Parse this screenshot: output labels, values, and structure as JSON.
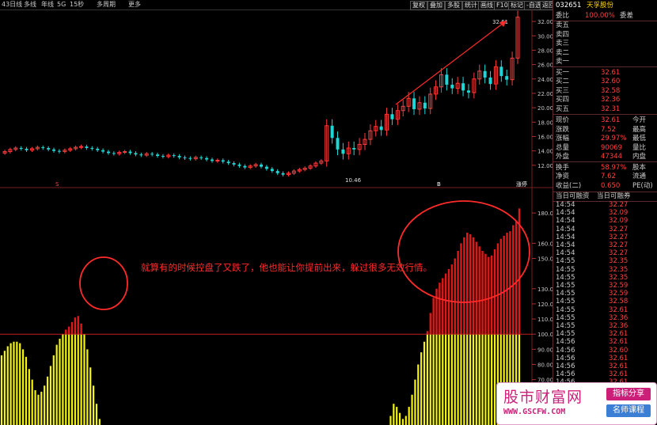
{
  "toolbar": {
    "items": [
      "43日线",
      "多线",
      "年线",
      "5G",
      "15秒",
      "多周期",
      "更多"
    ],
    "buttons": [
      "复权",
      "叠加",
      "多股",
      "统计",
      "画线",
      "F10",
      "标记",
      "-自选",
      "返回"
    ]
  },
  "colors": {
    "up": "#ff3b3b",
    "down": "#1fd6d6",
    "volume_yellow": "#f5f50a",
    "volume_red": "#e01818",
    "annotation": "#ff2b2b"
  },
  "annotation_text": "就算有的时候控盘了又跌了，他也能让你提前出来，躲过很多无效行情。",
  "chart_data": [
    {
      "type": "candlestick",
      "high_label": "32.61",
      "low_label": "10.46",
      "y_ticks": [
        "32.00",
        "30.00",
        "28.00",
        "26.00",
        "24.00",
        "22.00",
        "20.00",
        "18.00",
        "16.00",
        "14.00",
        "12.00"
      ],
      "ylim": [
        10.0,
        33.0
      ],
      "markers": [
        "S",
        "B",
        "涨停"
      ],
      "closes": [
        13.9,
        14.2,
        14.4,
        14.3,
        14.1,
        14.3,
        14.5,
        14.4,
        14.2,
        14.0,
        13.9,
        14.1,
        14.3,
        14.5,
        14.6,
        14.4,
        14.3,
        14.1,
        13.9,
        13.7,
        13.6,
        13.8,
        13.9,
        13.7,
        13.5,
        13.4,
        13.6,
        13.5,
        13.3,
        13.2,
        13.4,
        13.3,
        13.1,
        13.0,
        12.9,
        13.1,
        13.0,
        12.8,
        12.6,
        12.7,
        12.5,
        12.3,
        12.1,
        11.9,
        11.7,
        11.9,
        12.1,
        11.8,
        11.5,
        11.2,
        10.9,
        10.7,
        10.9,
        11.2,
        11.4,
        11.6,
        11.9,
        12.3,
        12.6,
        17.5,
        15.8,
        14.2,
        13.6,
        14.4,
        14.2,
        14.9,
        15.6,
        16.8,
        17.4,
        16.9,
        19.1,
        18.4,
        19.6,
        20.2,
        21.3,
        19.8,
        20.7,
        19.9,
        21.9,
        22.9,
        24.6,
        23.2,
        22.7,
        23.4,
        22.4,
        22.1,
        24.0,
        25.1,
        24.2,
        23.3,
        25.7,
        24.4,
        23.9,
        26.9,
        32.6
      ]
    },
    {
      "type": "bar",
      "y_ticks": [
        "180.00",
        "160.00",
        "150.00",
        "130.00",
        "120.00",
        "110.00",
        "100.00",
        "90.00",
        "80.00",
        "70.00",
        "60.00",
        "50.00",
        "46.00"
      ],
      "ylim": [
        40,
        190
      ],
      "threshold": 100,
      "values": [
        86,
        89,
        92,
        94,
        95,
        95,
        94,
        90,
        85,
        77,
        70,
        63,
        60,
        62,
        66,
        72,
        79,
        86,
        93,
        97,
        100,
        103,
        105,
        108,
        111,
        112,
        107,
        100,
        90,
        78,
        66,
        54,
        44,
        36,
        30,
        26,
        22,
        0,
        0,
        0,
        0,
        0,
        0,
        0,
        0,
        0,
        0,
        0,
        0,
        34,
        40,
        36,
        28,
        20,
        14,
        0,
        0,
        0,
        0,
        0,
        0,
        0,
        0,
        0,
        0,
        0,
        0,
        0,
        0,
        0,
        0,
        0,
        0,
        0,
        0,
        0,
        0,
        0,
        0,
        0,
        0,
        0,
        0,
        0,
        0,
        0,
        0,
        0,
        0,
        0,
        0,
        0,
        0,
        0,
        0,
        0,
        0,
        0,
        0,
        0,
        0,
        0,
        0,
        0,
        0,
        0,
        0,
        0,
        0,
        0,
        0,
        0,
        0,
        0,
        0,
        0,
        0,
        0,
        0,
        0,
        0,
        0,
        0,
        0,
        0,
        0,
        0,
        46,
        54,
        52,
        48,
        44,
        46,
        52,
        60,
        70,
        80,
        88,
        95,
        102,
        114,
        124,
        130,
        134,
        137,
        140,
        143,
        146,
        150,
        155,
        160,
        164,
        167,
        166,
        164,
        161,
        158,
        155,
        153,
        151,
        152,
        156,
        160,
        163,
        165,
        167,
        168,
        172,
        175,
        183
      ]
    }
  ],
  "panel": {
    "code": "032651",
    "name": "天孚股份",
    "weibi_label": "委比",
    "weibi_value": "100.00%",
    "weicha_label": "委差",
    "sell": [
      {
        "label": "卖五",
        "price": ""
      },
      {
        "label": "卖四",
        "price": ""
      },
      {
        "label": "卖三",
        "price": ""
      },
      {
        "label": "卖二",
        "price": ""
      },
      {
        "label": "卖一",
        "price": ""
      }
    ],
    "buy": [
      {
        "label": "买一",
        "price": "32.61"
      },
      {
        "label": "买二",
        "price": "32.60"
      },
      {
        "label": "买三",
        "price": "32.58"
      },
      {
        "label": "买四",
        "price": "32.36"
      },
      {
        "label": "买五",
        "price": "32.31"
      }
    ],
    "quote": [
      {
        "l1": "现价",
        "v1": "32.61",
        "l2": "今开",
        "v2": ""
      },
      {
        "l1": "涨跌",
        "v1": "7.52",
        "l2": "最高",
        "v2": ""
      },
      {
        "l1": "涨幅",
        "v1": "29.97%",
        "l2": "最低",
        "v2": ""
      },
      {
        "l1": "总量",
        "v1": "90069",
        "l2": "量比",
        "v2": ""
      },
      {
        "l1": "外盘",
        "v1": "47344",
        "l2": "内盘",
        "v2": ""
      }
    ],
    "extra": [
      {
        "l1": "换手",
        "v1": "58.97%",
        "l2": "股本",
        "v2": ""
      },
      {
        "l1": "净资",
        "v1": "7.62",
        "l2": "流通",
        "v2": ""
      },
      {
        "l1": "收益(二)",
        "v1": "0.650",
        "l2": "PE(动)",
        "v2": ""
      }
    ],
    "fund_labels": [
      "当日可融资",
      "当日可融券"
    ],
    "ticks": [
      {
        "t": "14:54",
        "p": "32.27"
      },
      {
        "t": "14:54",
        "p": "32.09"
      },
      {
        "t": "14:54",
        "p": "32.09"
      },
      {
        "t": "14:54",
        "p": "32.27"
      },
      {
        "t": "14:54",
        "p": "32.27"
      },
      {
        "t": "14:54",
        "p": "32.27"
      },
      {
        "t": "14:54",
        "p": "32.27"
      },
      {
        "t": "14:55",
        "p": "32.35"
      },
      {
        "t": "14:55",
        "p": "32.35"
      },
      {
        "t": "14:55",
        "p": "32.35"
      },
      {
        "t": "14:55",
        "p": "32.59"
      },
      {
        "t": "14:55",
        "p": "32.59"
      },
      {
        "t": "14:55",
        "p": "32.58"
      },
      {
        "t": "14:55",
        "p": "32.61"
      },
      {
        "t": "14:55",
        "p": "32.36"
      },
      {
        "t": "14:55",
        "p": "32.36"
      },
      {
        "t": "14:55",
        "p": "32.61"
      },
      {
        "t": "14:56",
        "p": "32.61"
      },
      {
        "t": "14:56",
        "p": "32.60"
      },
      {
        "t": "14:56",
        "p": "32.61"
      },
      {
        "t": "14:56",
        "p": "32.61"
      },
      {
        "t": "14:56",
        "p": "32.61"
      },
      {
        "t": "14:56",
        "p": "32.61"
      }
    ]
  },
  "watermark": {
    "main": "股市财富网",
    "url": "WWW.GSCFW.COM",
    "badge1": "指标分享",
    "badge2": "名师课程"
  }
}
